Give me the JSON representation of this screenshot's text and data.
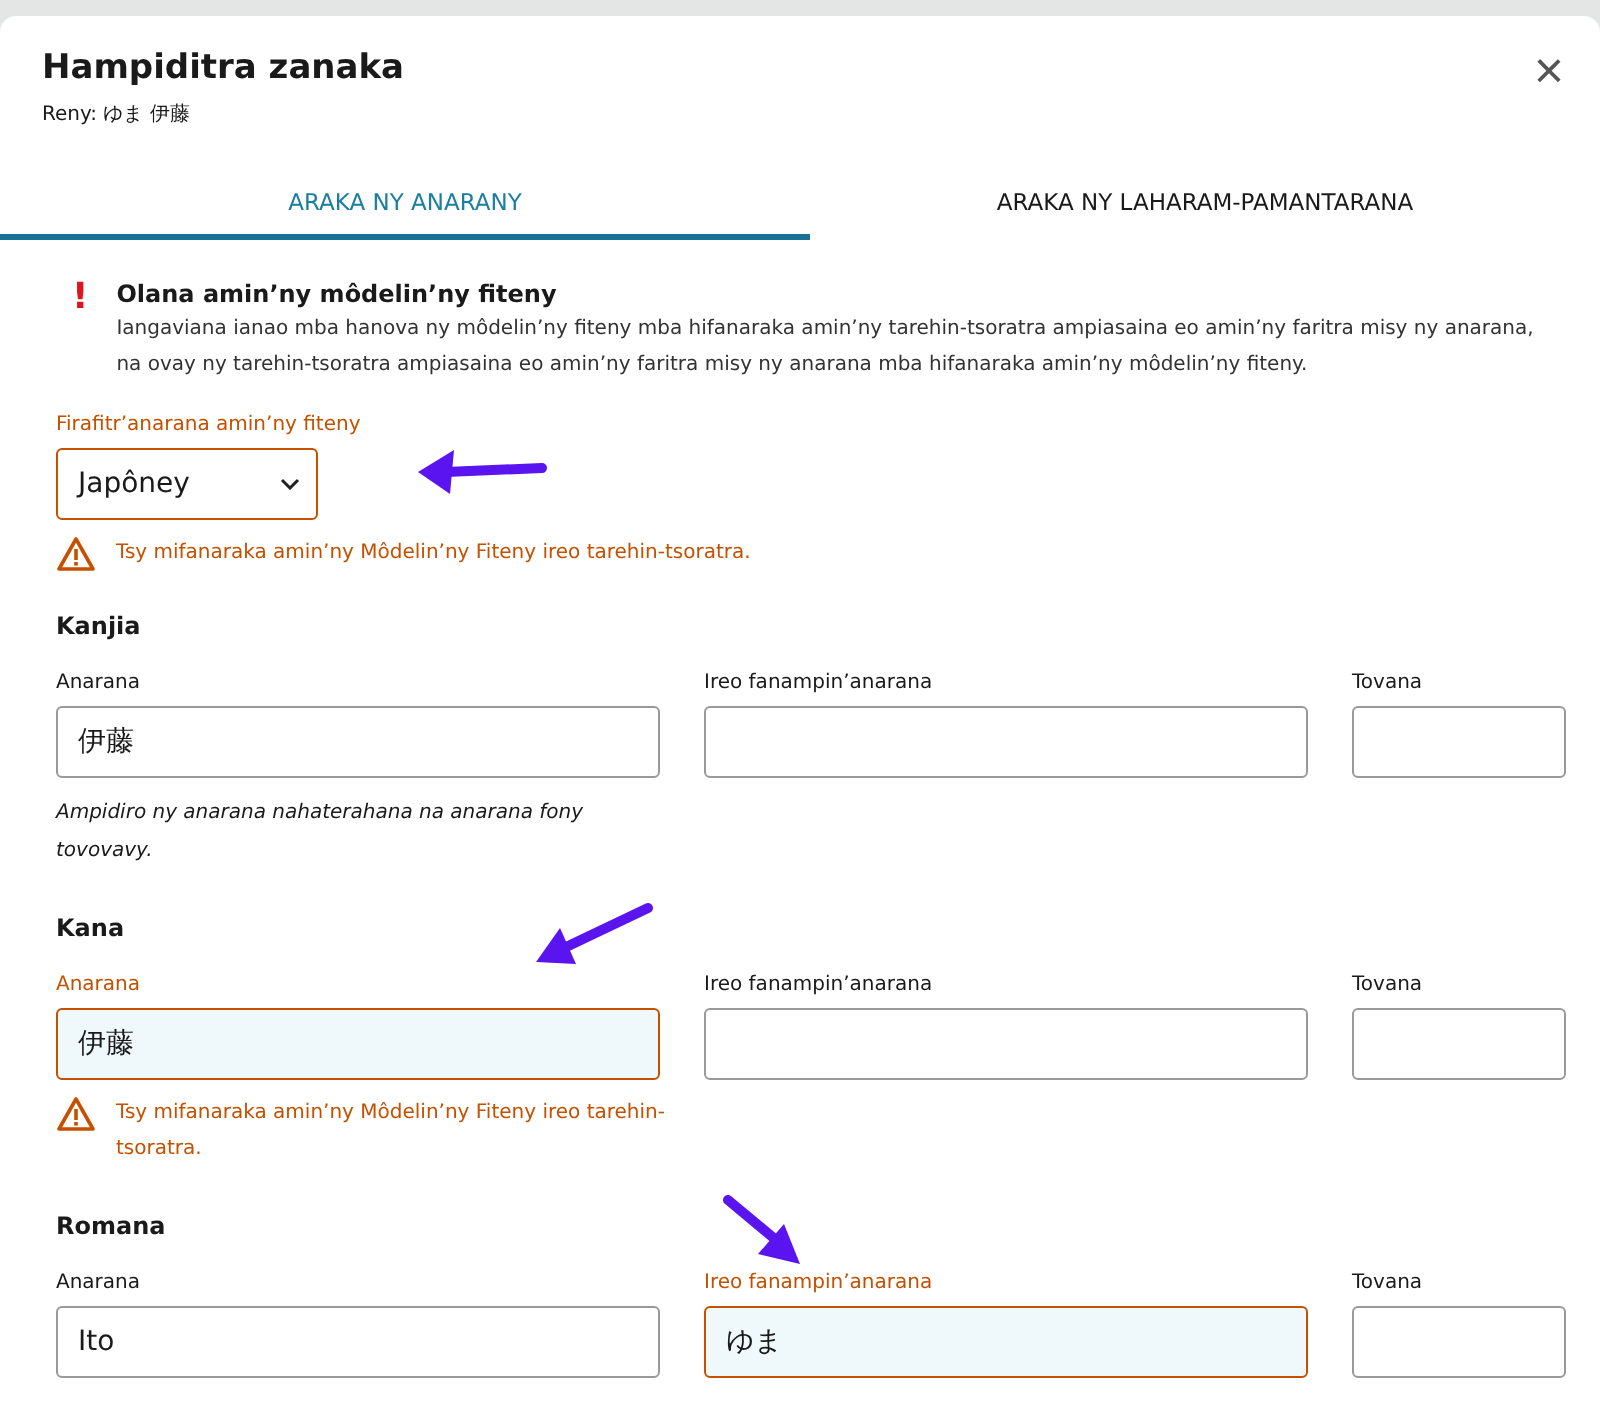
{
  "dialog": {
    "title": "Hampiditra zanaka",
    "subtitle": "Reny: ゆま 伊藤",
    "close": "×"
  },
  "tabs": [
    {
      "label": "ARAKA NY ANARANY",
      "selected": true
    },
    {
      "label": "ARAKA NY LAHARAM-PAMANTARANA",
      "selected": false
    }
  ],
  "alert": {
    "mark": "!",
    "title": "Olana amin’ny môdelin’ny fiteny",
    "text": "Iangaviana ianao mba hanova ny môdelin’ny fiteny mba hifanaraka amin’ny tarehin-tsoratra ampiasaina eo amin’ny faritra misy ny anarana, na ovay ny tarehin-tsoratra ampiasaina eo amin’ny faritra misy ny anarana mba hifanaraka amin’ny môdelin’ny fiteny."
  },
  "language": {
    "label": "Firafitr’anarana amin’ny fiteny",
    "value": "Japôney",
    "error": true,
    "warning": "Tsy mifanaraka amin’ny Môdelin’ny Fiteny ireo tarehin-tsoratra."
  },
  "sections": [
    {
      "title": "Kanjia",
      "fields": [
        {
          "label": "Anarana",
          "value": "伊藤",
          "error": false
        },
        {
          "label": "Ireo fanampin’anarana",
          "error": false
        },
        {
          "label": "Tovana",
          "error": false
        }
      ],
      "hint": "Ampidiro ny anarana nahaterahana na anarana fony tovovavy."
    },
    {
      "title": "Kana",
      "fields": [
        {
          "label": "Anarana",
          "value": "伊藤",
          "error": true
        },
        {
          "label": "Ireo fanampin’anarana",
          "error": false
        },
        {
          "label": "Tovana",
          "error": false
        }
      ],
      "warning": "Tsy mifanaraka amin’ny Môdelin’ny Fiteny ireo tarehin-tsoratra."
    },
    {
      "title": "Romana",
      "fields": [
        {
          "label": "Anarana",
          "value": "Ito",
          "error": false
        },
        {
          "label": "Ireo fanampin’anarana",
          "value": "ゆま",
          "error": true
        },
        {
          "label": "Tovana",
          "error": false
        }
      ]
    }
  ]
}
